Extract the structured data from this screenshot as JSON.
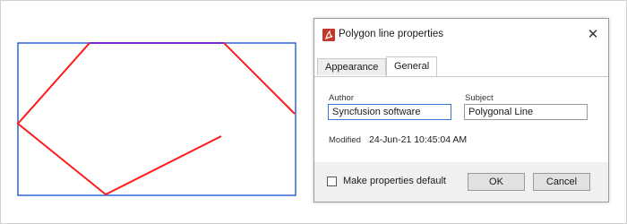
{
  "dialog": {
    "title": "Polygon line properties",
    "app_icon": "pdf-document-icon",
    "close_icon": "close-icon",
    "tabs": [
      {
        "label": "Appearance",
        "active": false
      },
      {
        "label": "General",
        "active": true
      }
    ],
    "author": {
      "label": "Author",
      "value": "Syncfusion software"
    },
    "subject": {
      "label": "Subject",
      "value": "Polygonal Line"
    },
    "modified": {
      "label": "Modified",
      "value": "24-Jun-21 10:45:04 AM"
    },
    "footer": {
      "make_default_label": "Make properties default",
      "make_default_checked": false,
      "ok_label": "OK",
      "cancel_label": "Cancel"
    }
  },
  "colors": {
    "annotation_bounds": "#2f64d6",
    "polyline_stroke": "#ff1a1a",
    "focus_border": "#3a78d6",
    "app_icon": "#c0392b"
  }
}
